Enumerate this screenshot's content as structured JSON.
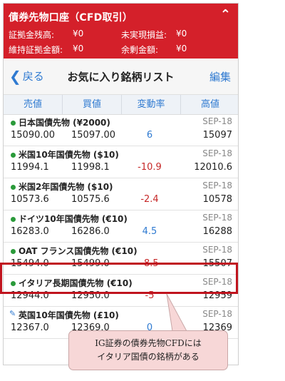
{
  "header": {
    "title": "債券先物口座（CFD取引）",
    "rows": [
      {
        "label1": "証拠金残高:",
        "value1": "¥0",
        "label2": "未実現損益:",
        "value2": "¥0"
      },
      {
        "label1": "維持証拠金額:",
        "value1": "¥0",
        "label2": "余剰金額:",
        "value2": "¥0"
      }
    ],
    "collapse_icon": "chevron-up"
  },
  "nav": {
    "back_label": "戻る",
    "title": "お気に入り銘柄リスト",
    "edit_label": "編集"
  },
  "columns": [
    "売値",
    "買値",
    "変動率",
    "高値"
  ],
  "rows": [
    {
      "name": "日本国債先物 (¥2000)",
      "month": "SEP-18",
      "bid": "15090.00",
      "ask": "15097.00",
      "change": "6",
      "dir": "pos",
      "high": "15097",
      "icon": "dot"
    },
    {
      "name": "米国10年国債先物 ($10)",
      "month": "SEP-18",
      "bid": "11994.1",
      "ask": "11998.1",
      "change": "-10.9",
      "dir": "neg",
      "high": "12010.6",
      "icon": "dot"
    },
    {
      "name": "米国2年国債先物 ($10)",
      "month": "SEP-18",
      "bid": "10573.6",
      "ask": "10575.6",
      "change": "-2.4",
      "dir": "neg",
      "high": "10578",
      "icon": "dot"
    },
    {
      "name": "ドイツ10年国債先物 (€10)",
      "month": "SEP-18",
      "bid": "16283.0",
      "ask": "16286.0",
      "change": "4.5",
      "dir": "pos",
      "high": "16288",
      "icon": "dot"
    },
    {
      "name": "OAT フランス国債先物 (€10)",
      "month": "SEP-18",
      "bid": "15494.0",
      "ask": "15499.0",
      "change": "-8.5",
      "dir": "neg",
      "high": "15507",
      "icon": "dot"
    },
    {
      "name": "イタリア長期国債先物 (€10)",
      "month": "SEP-18",
      "bid": "12944.0",
      "ask": "12950.0",
      "change": "-5",
      "dir": "neg",
      "high": "12959",
      "icon": "dot"
    },
    {
      "name": "英国10年国債先物 (£10)",
      "month": "SEP-18",
      "bid": "12367.0",
      "ask": "12369.0",
      "change": "0",
      "dir": "pos",
      "high": "12369",
      "icon": "pencil"
    }
  ],
  "callout": {
    "line1": "IG証券の債券先物CFDには",
    "line2": "イタリア国債の銘柄がある"
  },
  "colors": {
    "header_red": "#d4202a",
    "link_blue": "#2f7ad1",
    "dot_green": "#2a9a3a",
    "negative": "#c62828"
  }
}
